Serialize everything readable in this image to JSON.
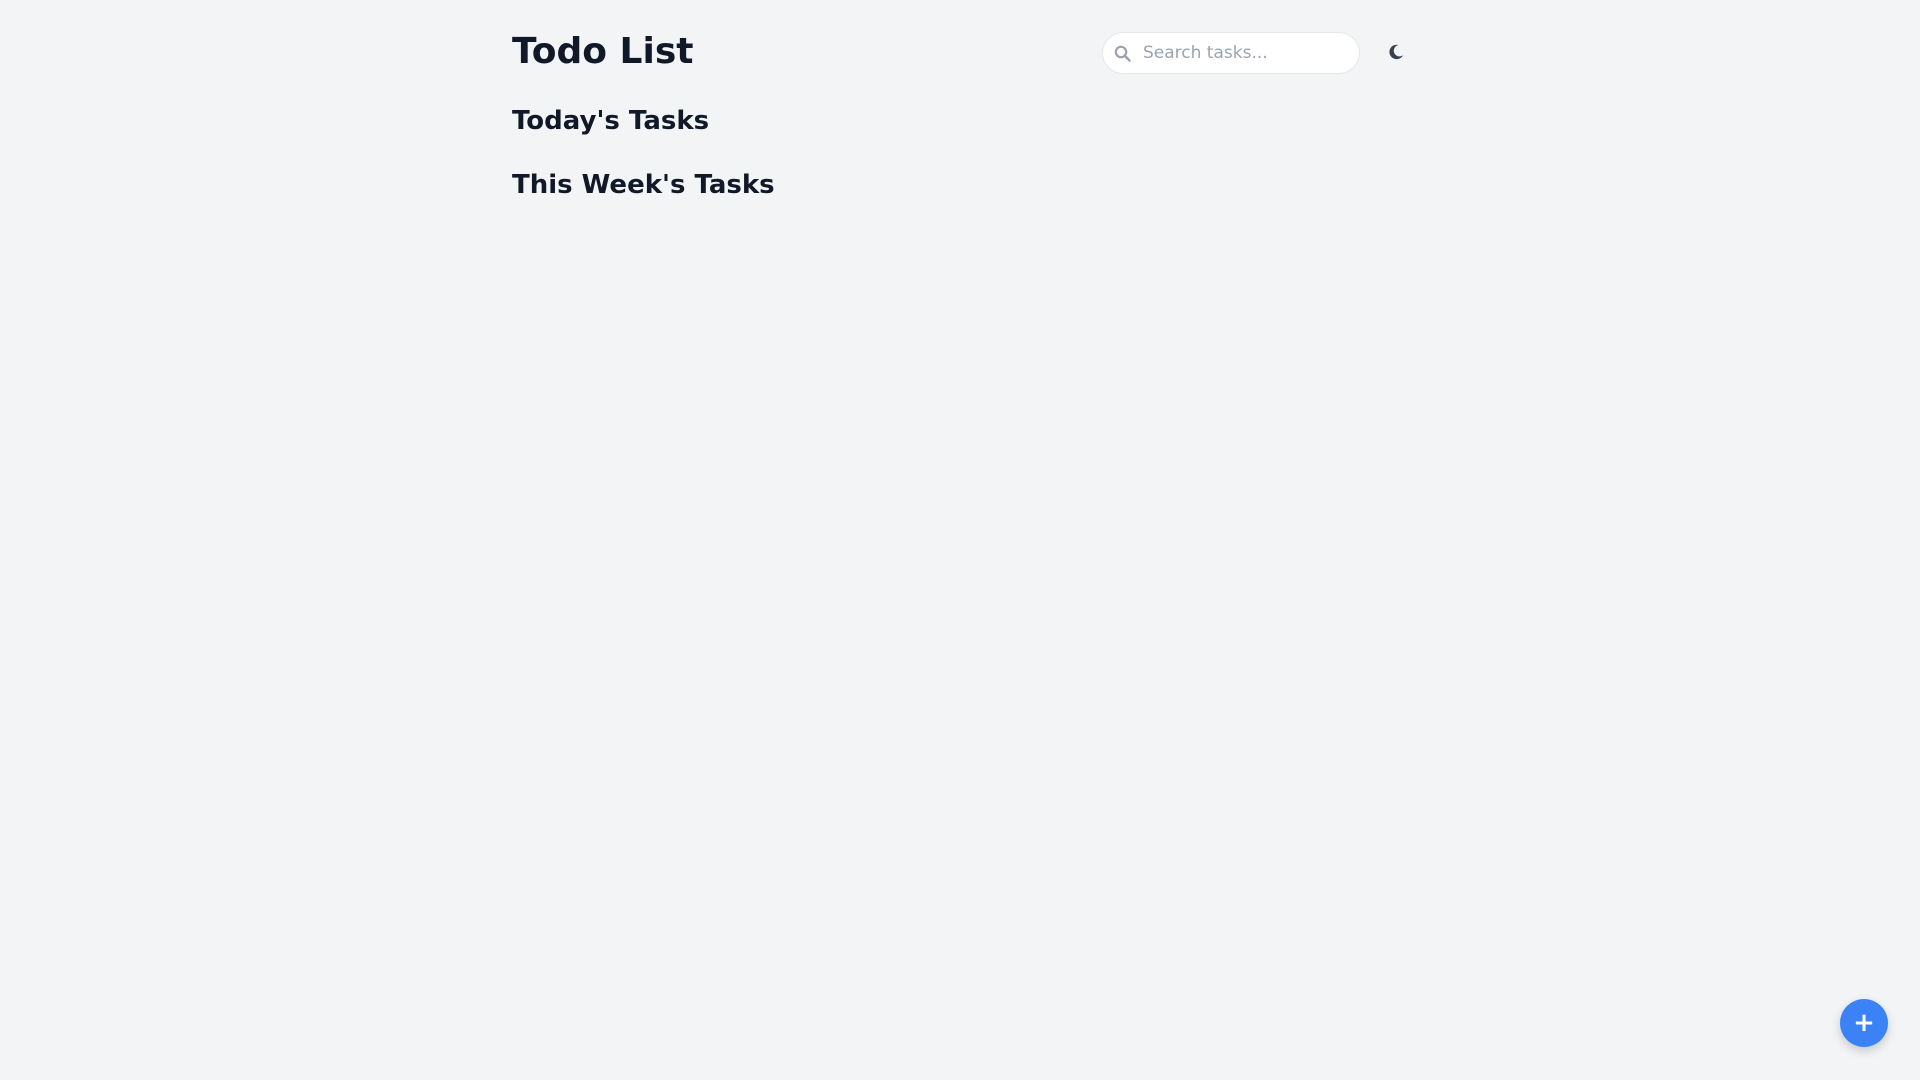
{
  "app": {
    "title": "Todo List"
  },
  "search": {
    "placeholder": "Search tasks...",
    "value": "",
    "icon": "search-icon"
  },
  "theme_toggle": {
    "icon": "moon-icon"
  },
  "sections": {
    "today_heading": "Today's Tasks",
    "week_heading": "This Week's Tasks"
  },
  "fab": {
    "symbol": "+",
    "icon": "plus-icon"
  },
  "colors": {
    "background": "#f3f4f6",
    "text": "#111827",
    "accent": "#3b82f6",
    "placeholder": "#9ca3af"
  }
}
